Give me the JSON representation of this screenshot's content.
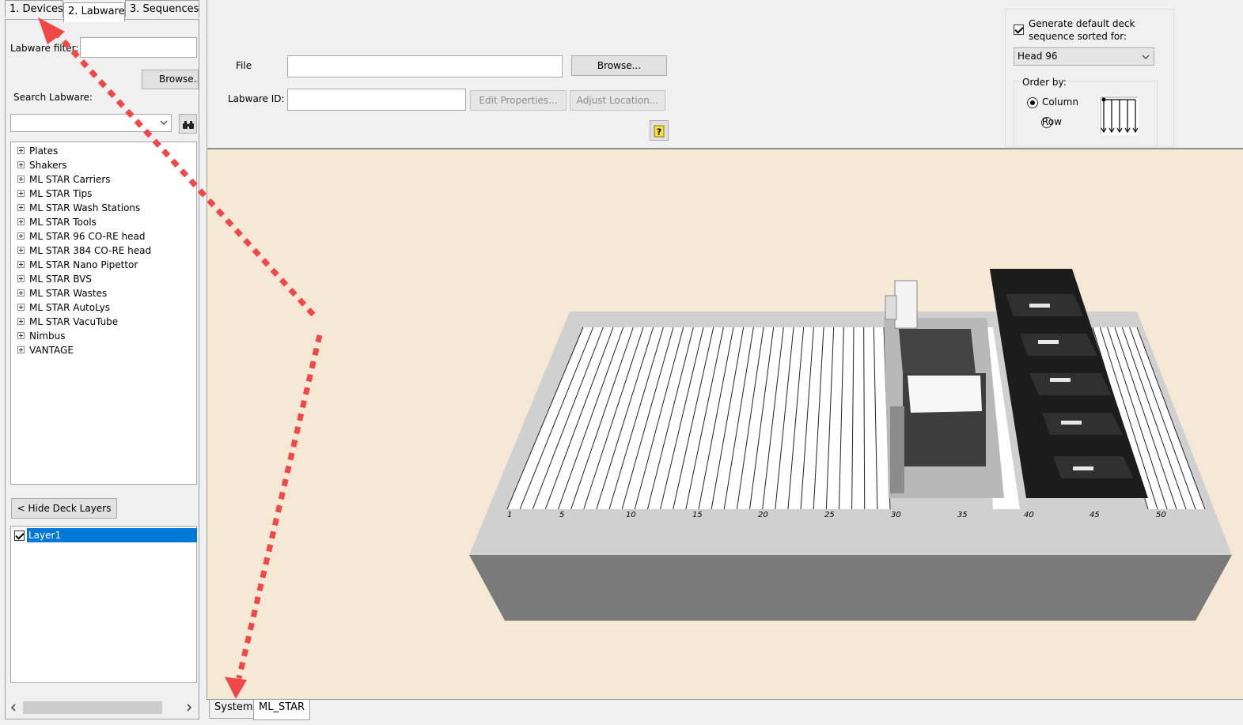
{
  "tabs": [
    {
      "label": "1. Devices"
    },
    {
      "label": "2. Labware"
    },
    {
      "label": "3. Sequences"
    }
  ],
  "labware_filter": {
    "label": "Labware filter:",
    "value": ""
  },
  "browse_left": {
    "label": "Browse..."
  },
  "search_labware": {
    "label": "Search Labware:",
    "value": ""
  },
  "tree": [
    "Plates",
    "Shakers",
    "ML STAR Carriers",
    "ML STAR Tips",
    "ML STAR Wash Stations",
    "ML STAR Tools",
    "ML STAR 96 CO-RE head",
    "ML STAR 384 CO-RE head",
    "ML STAR Nano Pipettor",
    "ML STAR BVS",
    "ML STAR Wastes",
    "ML STAR AutoLys",
    "ML STAR VacuTube",
    "Nimbus",
    "VANTAGE"
  ],
  "hide_layers": {
    "label": "< Hide Deck Layers"
  },
  "layers": [
    {
      "label": "Layer1",
      "checked": true
    }
  ],
  "file": {
    "label": "File",
    "value": "",
    "browse": "Browse..."
  },
  "labware_id": {
    "label": "Labware ID:",
    "value": "",
    "edit_props": "Edit Properties...",
    "adjust_loc": "Adjust Location..."
  },
  "help_icon": "question-icon",
  "deck_sequence": {
    "checkbox_label_1": "Generate default deck",
    "checkbox_label_2": "sequence sorted for:",
    "checked": true,
    "head_value": "Head 96",
    "order_by_label": "Order by:",
    "column_label": "Column",
    "row_label": "Row",
    "selected": "Column"
  },
  "deck": {
    "track_labels": [
      "1",
      "5",
      "10",
      "15",
      "20",
      "25",
      "30",
      "35",
      "40",
      "45",
      "50"
    ],
    "background": "#f5e9d5"
  },
  "bottom_tabs": [
    {
      "label": "System"
    },
    {
      "label": "ML_STAR"
    }
  ],
  "annotation_color": "#f04848"
}
